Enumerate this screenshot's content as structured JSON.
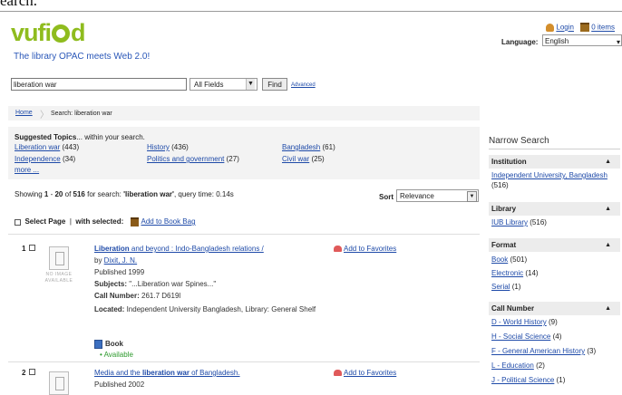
{
  "page_top_fragment": "earch.",
  "header": {
    "tagline": "The library OPAC meets Web 2.0!",
    "login_label": "Login",
    "items_label": "0 items",
    "language_label": "Language:",
    "language_value": "English"
  },
  "search": {
    "query": "liberation war",
    "field_value": "All Fields",
    "find_label": "Find",
    "advanced_label": "Advanced"
  },
  "breadcrumb": {
    "home": "Home",
    "current": "Search: liberation war"
  },
  "suggested": {
    "title_bold": "Suggested Topics",
    "title_rest": "... within your search.",
    "topics": [
      {
        "label": "Liberation war",
        "count": "(443)"
      },
      {
        "label": "History",
        "count": "(436)"
      },
      {
        "label": "Bangladesh",
        "count": "(61)"
      },
      {
        "label": "Independence",
        "count": "(34)"
      },
      {
        "label": "Politics and government",
        "count": "(27)"
      },
      {
        "label": "Civil war",
        "count": "(25)"
      }
    ],
    "more_label": "more ..."
  },
  "results_info": {
    "prefix": "Showing ",
    "range_start": "1",
    "mid1": " - ",
    "range_end": "20",
    "mid2": " of ",
    "total": "516",
    "mid3": " for search: ",
    "query_quoted": "'liberation war'",
    "suffix": ", query time: 0.14s"
  },
  "sort": {
    "label": "Sort",
    "value": "Relevance"
  },
  "select_row": {
    "select_page_label": "Select Page",
    "divider": "|",
    "with_selected_label": "with selected:",
    "add_to_bag_label": "Add to Book Bag"
  },
  "no_image_text": "NO IMAGE AVAILABLE",
  "results": [
    {
      "num": "1",
      "title_bold": "Liberation",
      "title_rest": " and beyond : Indo-Bangladesh relations /",
      "by_prefix": "by ",
      "author": "Dixit, J. N.",
      "published": "Published 1999",
      "subjects_label": "Subjects:",
      "subjects_value": " \"...Liberation war Spines...\"",
      "call_label": "Call Number:",
      "call_value": " 261.7 D619l",
      "located_label": "Located:",
      "located_value": " Independent University Bangladesh, Library: General Shelf",
      "format": "Book",
      "availability": "Available",
      "favorite_label": "Add to Favorites"
    },
    {
      "num": "2",
      "title_pre": "Media and the ",
      "title_bold": "liberation war",
      "title_rest": " of Bangladesh.",
      "published": "Published 2002",
      "favorite_label": "Add to Favorites"
    }
  ],
  "narrow": {
    "title": "Narrow Search",
    "facets": [
      {
        "name": "Institution",
        "items": [
          {
            "label": "Independent University, Bangladesh",
            "count": "(516)"
          }
        ]
      },
      {
        "name": "Library",
        "items": [
          {
            "label": "IUB Library",
            "count": "(516)"
          }
        ]
      },
      {
        "name": "Format",
        "items": [
          {
            "label": "Book",
            "count": "(501)"
          },
          {
            "label": "Electronic",
            "count": "(14)"
          },
          {
            "label": "Serial",
            "count": "(1)"
          }
        ]
      },
      {
        "name": "Call Number",
        "items": [
          {
            "label": "D - World History",
            "count": "(9)"
          },
          {
            "label": "H - Social Science",
            "count": "(4)"
          },
          {
            "label": "F - General American History",
            "count": "(3)"
          },
          {
            "label": "L - Education",
            "count": "(2)"
          },
          {
            "label": "J - Political Science",
            "count": "(1)"
          }
        ]
      }
    ]
  }
}
